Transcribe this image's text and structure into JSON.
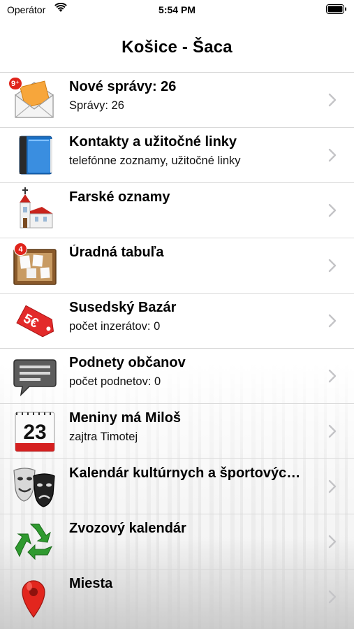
{
  "status_bar": {
    "carrier": "Operátor",
    "time": "5:54 PM"
  },
  "nav": {
    "title": "Košice - Šaca"
  },
  "rows": [
    {
      "title": "Nové správy: 26",
      "subtitle": "Správy: 26",
      "icon": "mail-icon",
      "badge": "9⁺"
    },
    {
      "title": "Kontakty a užitočné linky",
      "subtitle": "telefónne zoznamy, užitočné linky",
      "icon": "contacts-book-icon"
    },
    {
      "title": "Farské oznamy",
      "subtitle": "",
      "icon": "church-icon"
    },
    {
      "title": "Úradná tabuľa",
      "subtitle": "",
      "icon": "notice-board-icon",
      "badge": "4"
    },
    {
      "title": "Susedský Bazár",
      "subtitle": "počet inzerátov: 0",
      "icon": "price-tag-icon",
      "tag_text": "5€"
    },
    {
      "title": "Podnety občanov",
      "subtitle": "počet podnetov: 0",
      "icon": "speech-bubble-icon"
    },
    {
      "title": "Meniny má Miloš",
      "subtitle": "zajtra Timotej",
      "icon": "calendar-icon",
      "calendar_day": "23"
    },
    {
      "title": "Kalendár kultúrnych a športovýc…",
      "subtitle": "",
      "icon": "theatre-masks-icon"
    },
    {
      "title": "Zvozový kalendár",
      "subtitle": "",
      "icon": "recycle-icon"
    },
    {
      "title": "Miesta",
      "subtitle": "",
      "icon": "map-pin-icon"
    }
  ]
}
